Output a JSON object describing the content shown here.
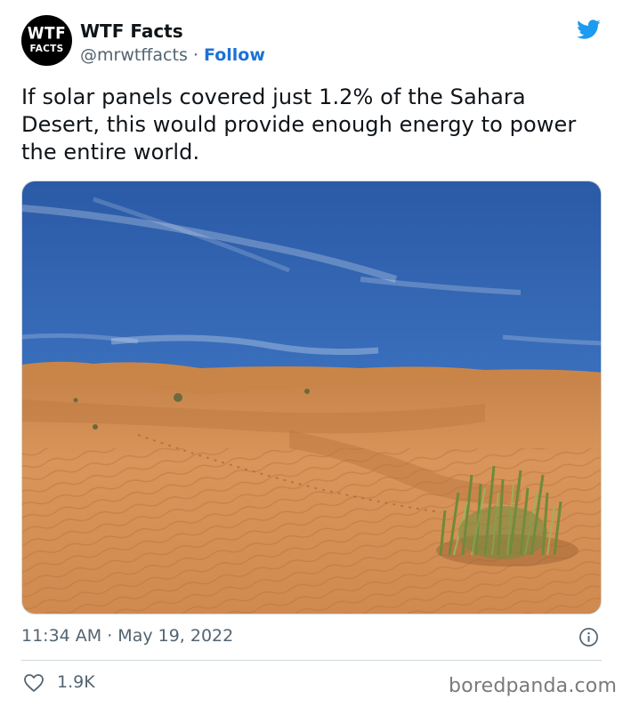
{
  "author": {
    "avatar_line1": "WTF",
    "avatar_line2": "FACTS",
    "display_name": "WTF Facts",
    "handle": "@mrwtffacts",
    "separator": "·",
    "follow_label": "Follow"
  },
  "tweet": {
    "text": "If solar panels covered just 1.2% of the Sahara Desert, this would provide enough energy to power the entire world.",
    "timestamp": "11:34 AM · May 19, 2022",
    "like_count": "1.9K"
  },
  "icons": {
    "brand": "twitter-bird-icon",
    "info": "info-icon",
    "like": "heart-icon"
  },
  "watermark": "boredpanda.com",
  "colors": {
    "twitter_blue": "#1d9bf0",
    "link_blue": "#1b72d6",
    "secondary_text": "#536471"
  }
}
